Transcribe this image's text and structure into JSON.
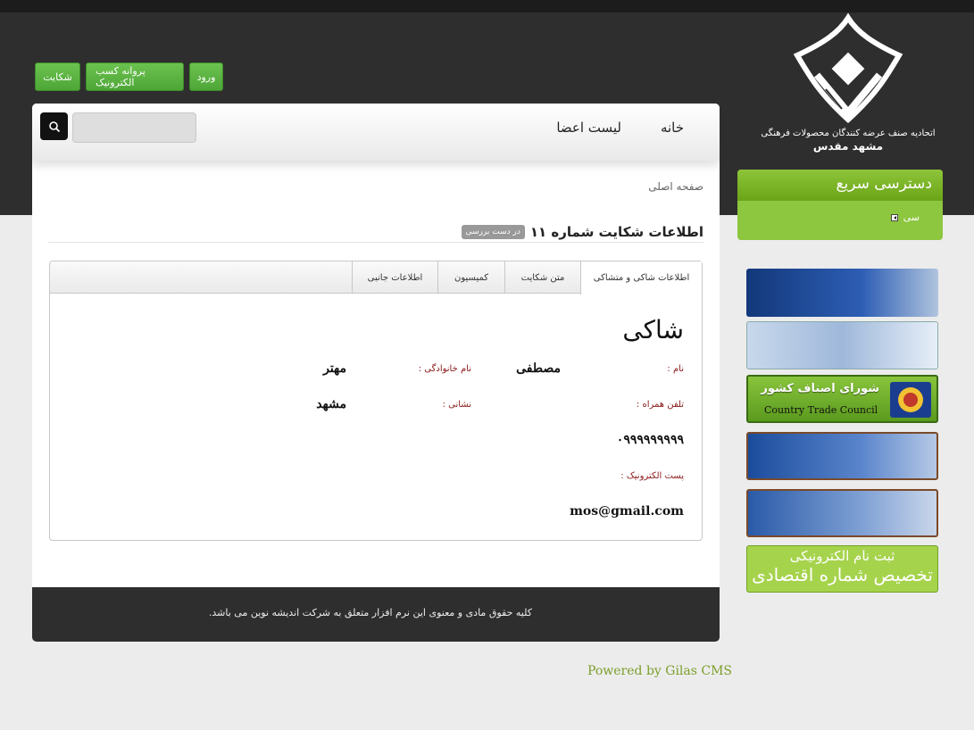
{
  "header": {
    "buttons": [
      "شکایت",
      "پروانه کسب الکترونیک",
      "ورود"
    ],
    "org_name": "اتحادیه صنف عرضه کنندگان محصولات فرهنگی",
    "org_city": "مشهد مقدس"
  },
  "nav": {
    "home": "خانه",
    "members": "لیست اعضا",
    "search_placeholder": ""
  },
  "breadcrumb": "صفحه اصلی",
  "page": {
    "title": "اطلاعات شکایت شماره ۱۱",
    "status_badge": "در دست بررسی"
  },
  "tabs": [
    "اطلاعات شاکی و متشاکی",
    "متن شکایت",
    "کمیسیون",
    "اطلاعات جانبی"
  ],
  "complainant": {
    "section_title": "شاکی",
    "name_label": "نام :",
    "name": "مصطفی",
    "family_label": "نام خانوادگی :",
    "family": "مهتر",
    "mobile_label": "تلفن همراه :",
    "mobile": "۰۹۹۹۹۹۹۹۹۹",
    "address_label": "نشانی :",
    "address": "مشهد",
    "email_label": "پست الکترونیک :",
    "email": "mos@gmail.com"
  },
  "footer": {
    "copyright": "کلیه حقوق مادی و معنوی این نرم افزار متعلق به شرکت اندیشه نوین می باشد.",
    "powered": "Powered by Gilas CMS"
  },
  "sidebar": {
    "quick_title": "دسترسی سریع",
    "quick_items": [
      "سی"
    ],
    "banners": {
      "b3_title": "شورای اصناف کشور",
      "b3_sub": "Country Trade Council",
      "b6_line1": "ثبت نام الکترونیکی",
      "b6_line2": "تخصیص شماره اقتصادی"
    }
  }
}
